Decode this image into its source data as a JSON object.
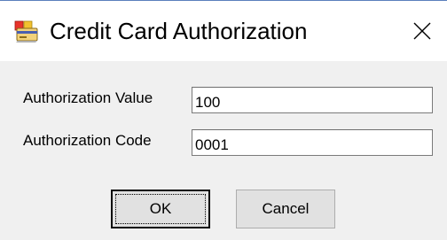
{
  "window": {
    "title": "Credit Card Authorization",
    "icon": "credit-card-app-icon",
    "close_icon": "close-icon"
  },
  "form": {
    "authorization_value_label": "Authorization Value",
    "authorization_value": "100",
    "authorization_code_label": "Authorization Code",
    "authorization_code": "0001"
  },
  "buttons": {
    "ok_label": "OK",
    "cancel_label": "Cancel"
  },
  "colors": {
    "window_border": "#5b7fbd",
    "client_background": "#f0f0f0",
    "titlebar_background": "#ffffff",
    "button_background": "#e1e1e1"
  }
}
